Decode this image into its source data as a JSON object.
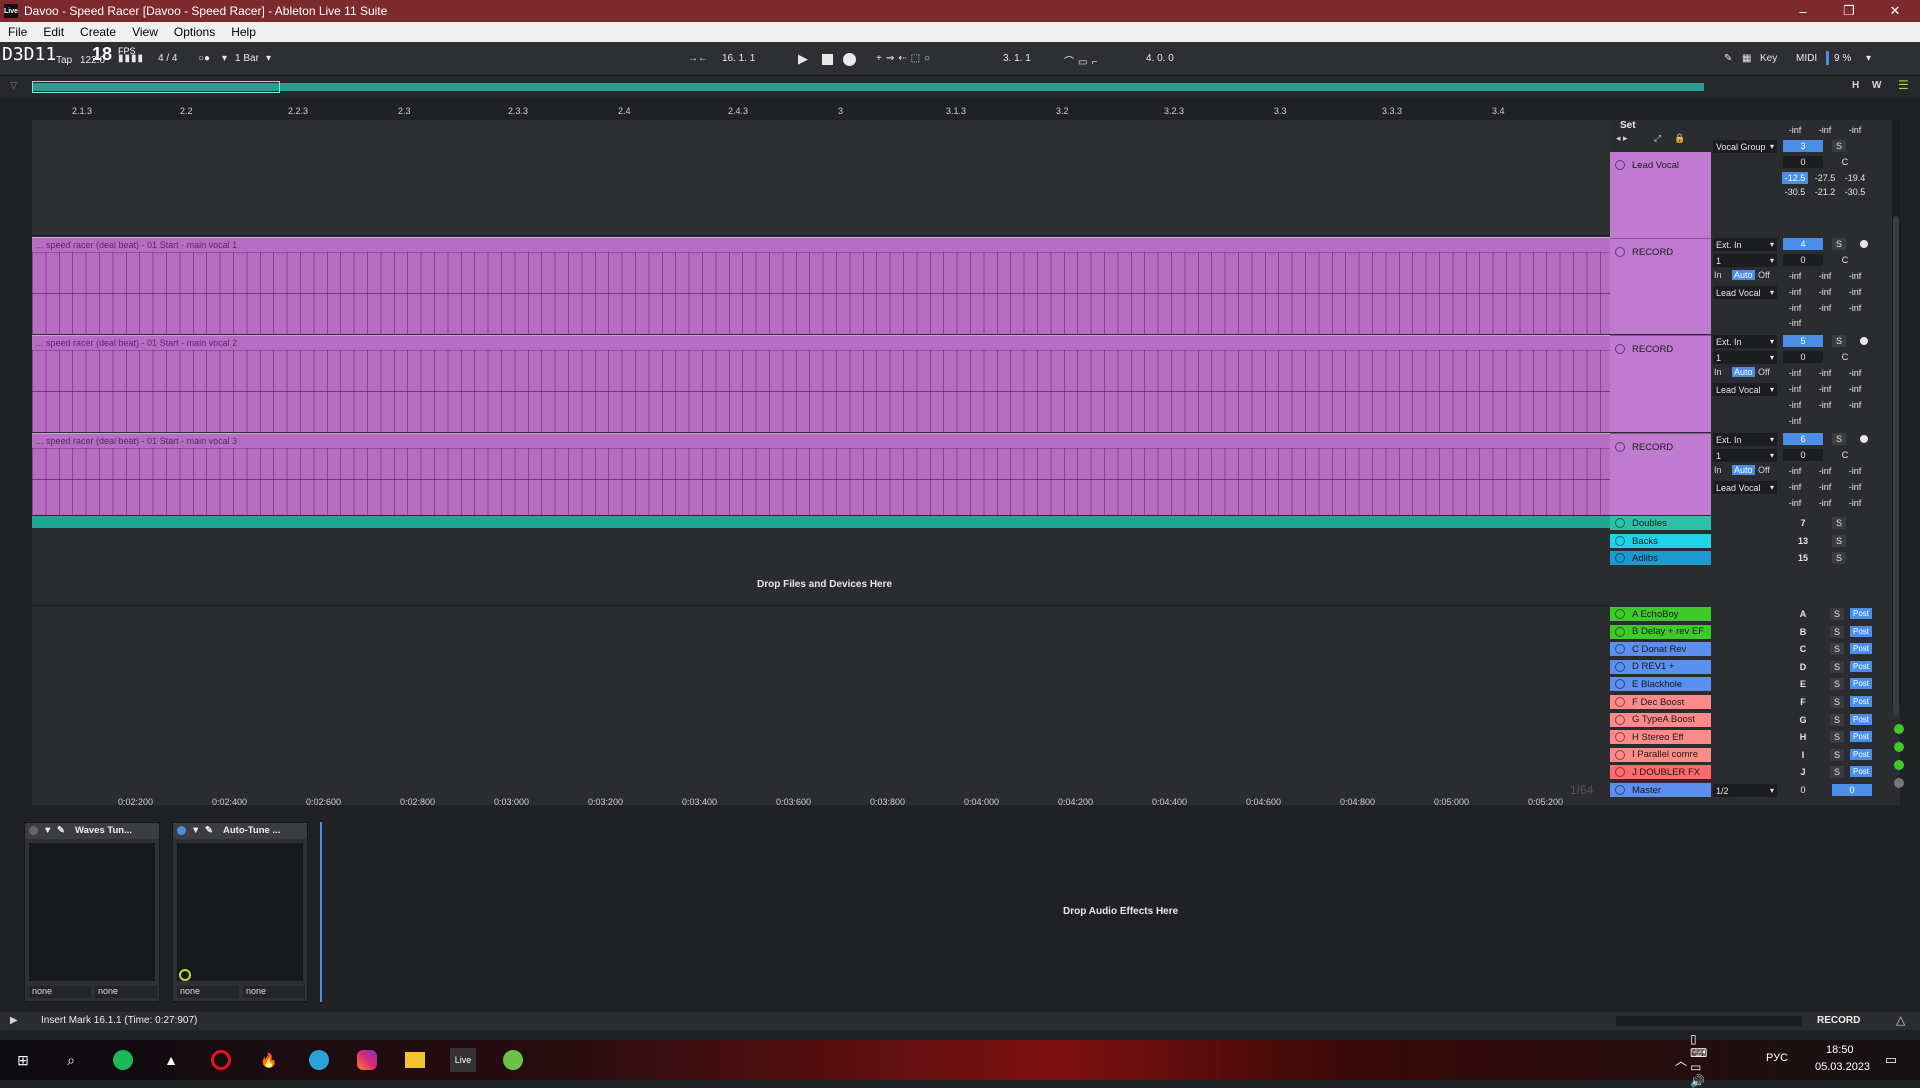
{
  "window": {
    "title": "Davoo - Speed Racer  [Davoo - Speed Racer] - Ableton Live 11 Suite",
    "logo": "Live"
  },
  "menu": [
    "File",
    "Edit",
    "Create",
    "View",
    "Options",
    "Help"
  ],
  "control": {
    "fps_overlay": "D3D11",
    "fps_value": "18",
    "fps_label": "FPS",
    "tap": "Tap",
    "tempo": "122.0",
    "signature": "4 / 4",
    "quantize": "1 Bar",
    "arr_position": "16.  1.  1",
    "loop_start": "3.  1.  1",
    "loop_length": "4.  0.  0",
    "key_label": "Key",
    "midi_label": "MIDI",
    "cpu": "9 %",
    "h_label": "H",
    "w_label": "W"
  },
  "ruler": [
    "2.1.3",
    "2.2",
    "2.2.3",
    "2.3",
    "2.3.3",
    "2.4",
    "2.4.3",
    "3",
    "3.1.3",
    "3.2",
    "3.2.3",
    "3.3",
    "3.3.3",
    "3.4"
  ],
  "time_ruler": [
    "0:02:200",
    "0:02:400",
    "0:02:600",
    "0:02:800",
    "0:03:000",
    "0:03:200",
    "0:03:400",
    "0:03:600",
    "0:03:800",
    "0:04:000",
    "0:04:200",
    "0:04:400",
    "0:04:600",
    "0:04:800",
    "0:05:000",
    "0:05:200"
  ],
  "arrangement": {
    "clips": [
      {
        "name": "... speed racer (deal beat) - 01 Start - main vocal  1"
      },
      {
        "name": "... speed racer (deal beat) - 01 Start - main vocal  2"
      },
      {
        "name": "... speed racer (deal beat) - 01 Start - main vocal  3"
      }
    ],
    "drop_files": "Drop Files and Devices Here",
    "zoom_readout": "1/64"
  },
  "mixer": {
    "set_label": "Set",
    "inf": "-inf",
    "group": {
      "name": "Lead Vocal",
      "routing": "Vocal Group",
      "number": "3",
      "vol": "0",
      "pan": "C",
      "meters": [
        "-12.5",
        "-27.5",
        "-19.4",
        "-30.5",
        "-21.2",
        "-30.5"
      ]
    },
    "record_tracks": [
      {
        "name": "RECORD",
        "input": "Ext. In",
        "channel": "1",
        "number": "4",
        "vol": "0",
        "pan": "C",
        "monitor": [
          "In",
          "Auto",
          "Off"
        ],
        "output": "Lead Vocal"
      },
      {
        "name": "RECORD",
        "input": "Ext. In",
        "channel": "1",
        "number": "5",
        "vol": "0",
        "pan": "C",
        "monitor": [
          "In",
          "Auto",
          "Off"
        ],
        "output": "Lead Vocal"
      },
      {
        "name": "RECORD",
        "input": "Ext. In",
        "channel": "1",
        "number": "6",
        "vol": "0",
        "pan": "C",
        "monitor": [
          "In",
          "Auto",
          "Off"
        ],
        "output": "Lead Vocal"
      }
    ],
    "groups": [
      {
        "name": "Doubles",
        "number": "7",
        "color": "#2bc1a6"
      },
      {
        "name": "Backs",
        "number": "13",
        "color": "#1fd3e6"
      },
      {
        "name": "Adlibs",
        "number": "15",
        "color": "#1c9ad0"
      }
    ],
    "returns": [
      {
        "name": "A EchoBoy",
        "letter": "A",
        "color": "#3ecb2a"
      },
      {
        "name": "B Delay + rev EF",
        "letter": "B",
        "color": "#3ecb2a"
      },
      {
        "name": "C Donat Rev",
        "letter": "C",
        "color": "#5b8ff0"
      },
      {
        "name": "D REV1 +",
        "letter": "D",
        "color": "#5b8ff0"
      },
      {
        "name": "E Blackhole",
        "letter": "E",
        "color": "#5b8ff0"
      },
      {
        "name": "F Dec Boost",
        "letter": "F",
        "color": "#ff8a8a"
      },
      {
        "name": "G TypeA Boost",
        "letter": "G",
        "color": "#ff8a8a"
      },
      {
        "name": "H Stereo Eff",
        "letter": "H",
        "color": "#ff8a8a"
      },
      {
        "name": "I Parallel comre",
        "letter": "I",
        "color": "#ff8a8a"
      },
      {
        "name": "J DOUBLER FX",
        "letter": "J",
        "color": "#ff6a6a"
      }
    ],
    "solo": "S",
    "post": "Post",
    "master": {
      "name": "Master",
      "output": "1/2",
      "vol": "0",
      "pan": "0",
      "color": "#5b8ff0"
    }
  },
  "devices": [
    {
      "name": "Waves Tun...",
      "left": "none",
      "right": "none"
    },
    {
      "name": "Auto-Tune ...",
      "left": "none",
      "right": "none"
    }
  ],
  "device_drop": "Drop Audio Effects Here",
  "status": {
    "text": "Insert Mark 16.1.1 (Time: 0:27:907)",
    "record": "RECORD"
  },
  "taskbar": {
    "lang": "РУС",
    "time": "18:50",
    "date": "05.03.2023",
    "live_label": "Live"
  }
}
